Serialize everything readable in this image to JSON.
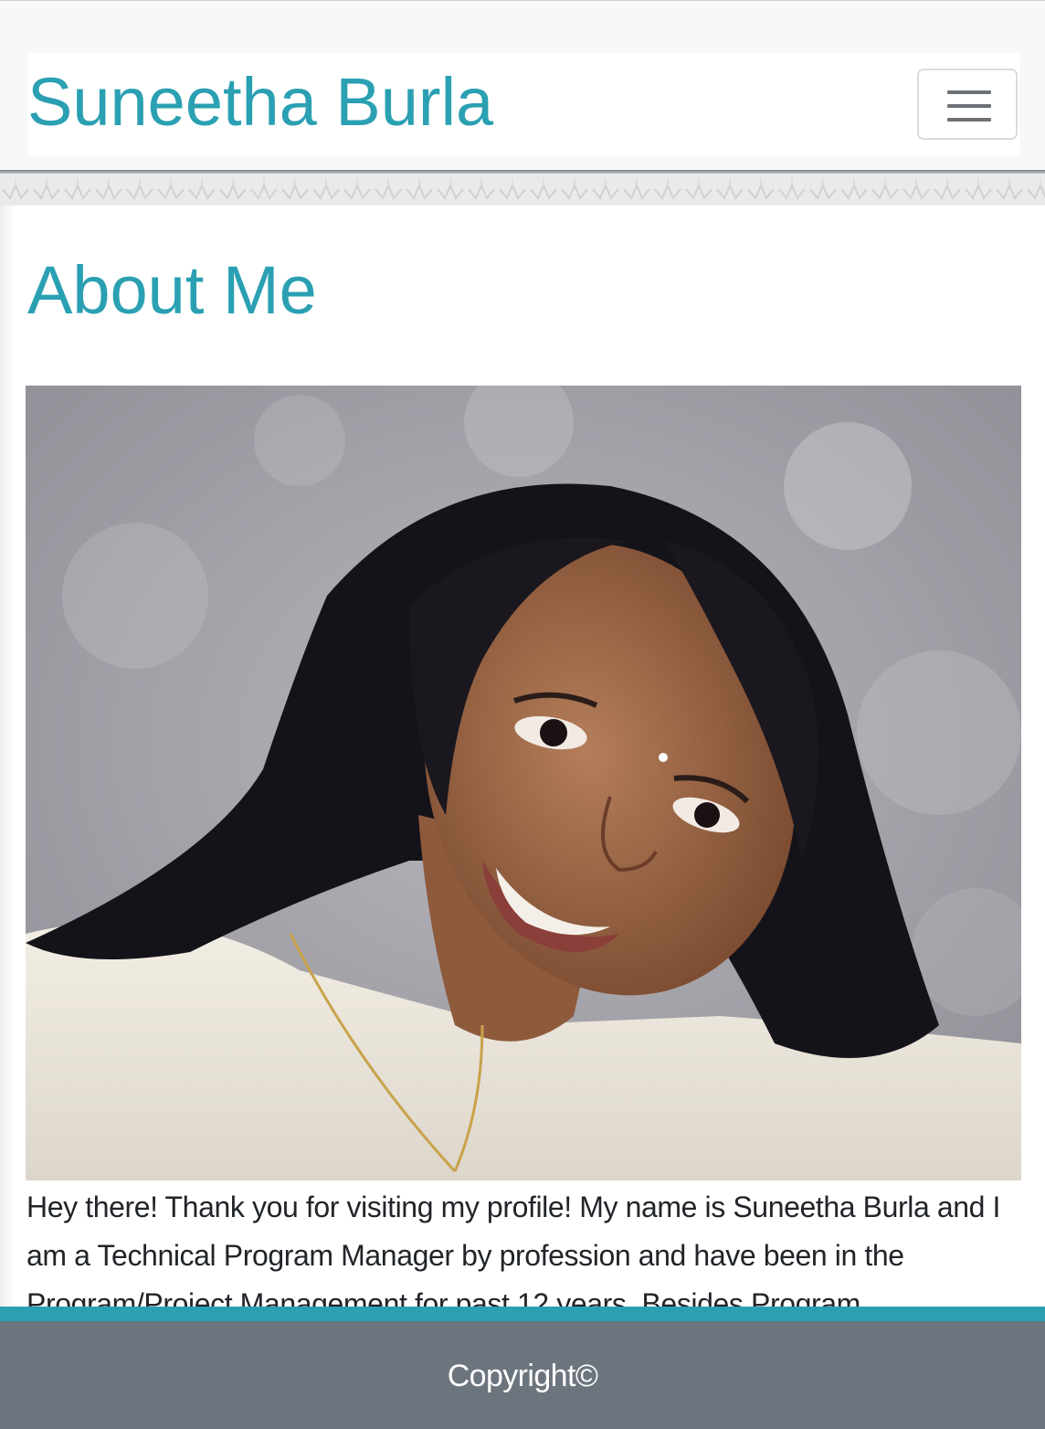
{
  "header": {
    "brand": "Suneetha Burla",
    "menu_toggle_icon": "hamburger-icon"
  },
  "main": {
    "heading": "About Me",
    "photo": {
      "description_icon": "portrait-photo",
      "background_color": "#a8a6ad"
    },
    "bio": "Hey there! Thank you for visiting my profile! My name is Suneetha Burla and I am a Technical Program Manager by profession and have been in the Program/Project Management for past 12 years. Besides Program"
  },
  "footer": {
    "copyright": "Copyright©"
  },
  "colors": {
    "accent": "#2aa0b2",
    "footer_bg": "#6c757d",
    "text": "#212529"
  }
}
